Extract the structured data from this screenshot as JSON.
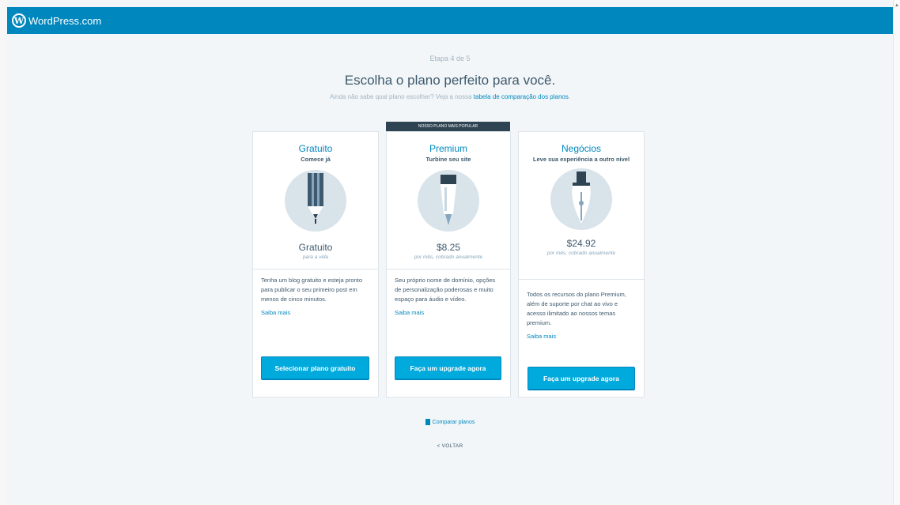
{
  "header": {
    "brand": "WordPress.com",
    "logo_letter": "W"
  },
  "step": "Etapa 4 de 5",
  "title": "Escolha o plano perfeito para você.",
  "subtitle_prefix": "Ainda não sabe qual plano escolher? Veja a nossa ",
  "subtitle_link": "tabela de comparação dos planos",
  "subtitle_suffix": ".",
  "badge": "NOSSO PLANO MAIS POPULAR",
  "plans": [
    {
      "name": "Gratuito",
      "tagline": "Comece já",
      "icon": "pencil-icon",
      "price": "Gratuito",
      "price_note": "para a vida",
      "description": "Tenha um blog gratuito e esteja pronto para publicar o seu primeiro post em menos de cinco minutos.",
      "more": "Saiba mais",
      "button": "Selecionar plano gratuito"
    },
    {
      "name": "Premium",
      "tagline": "Turbine seu site",
      "icon": "marker-pen-icon",
      "price": "$8.25",
      "price_note": "por mês, cobrado anualmente",
      "description": "Seu próprio nome de domínio, opções de personalização poderosas e muito espaço para áudio e vídeo.",
      "more": "Saiba mais",
      "button": "Faça um upgrade agora"
    },
    {
      "name": "Negócios",
      "tagline": "Leve sua experiência a outro nível",
      "icon": "fountain-pen-icon",
      "price": "$24.92",
      "price_note": "por mês, cobrado anualmente",
      "description": "Todos os recursos do plano Premium, além de suporte por chat ao vivo e acesso ilimitado ao nossos temas premium.",
      "more": "Saiba mais",
      "button": "Faça um upgrade agora"
    }
  ],
  "compare_link": "Comparar planos",
  "back_link": "< VOLTAR",
  "colors": {
    "header": "#0087be",
    "button": "#00aadc",
    "accent": "#0087be",
    "badge": "#2e4453"
  }
}
